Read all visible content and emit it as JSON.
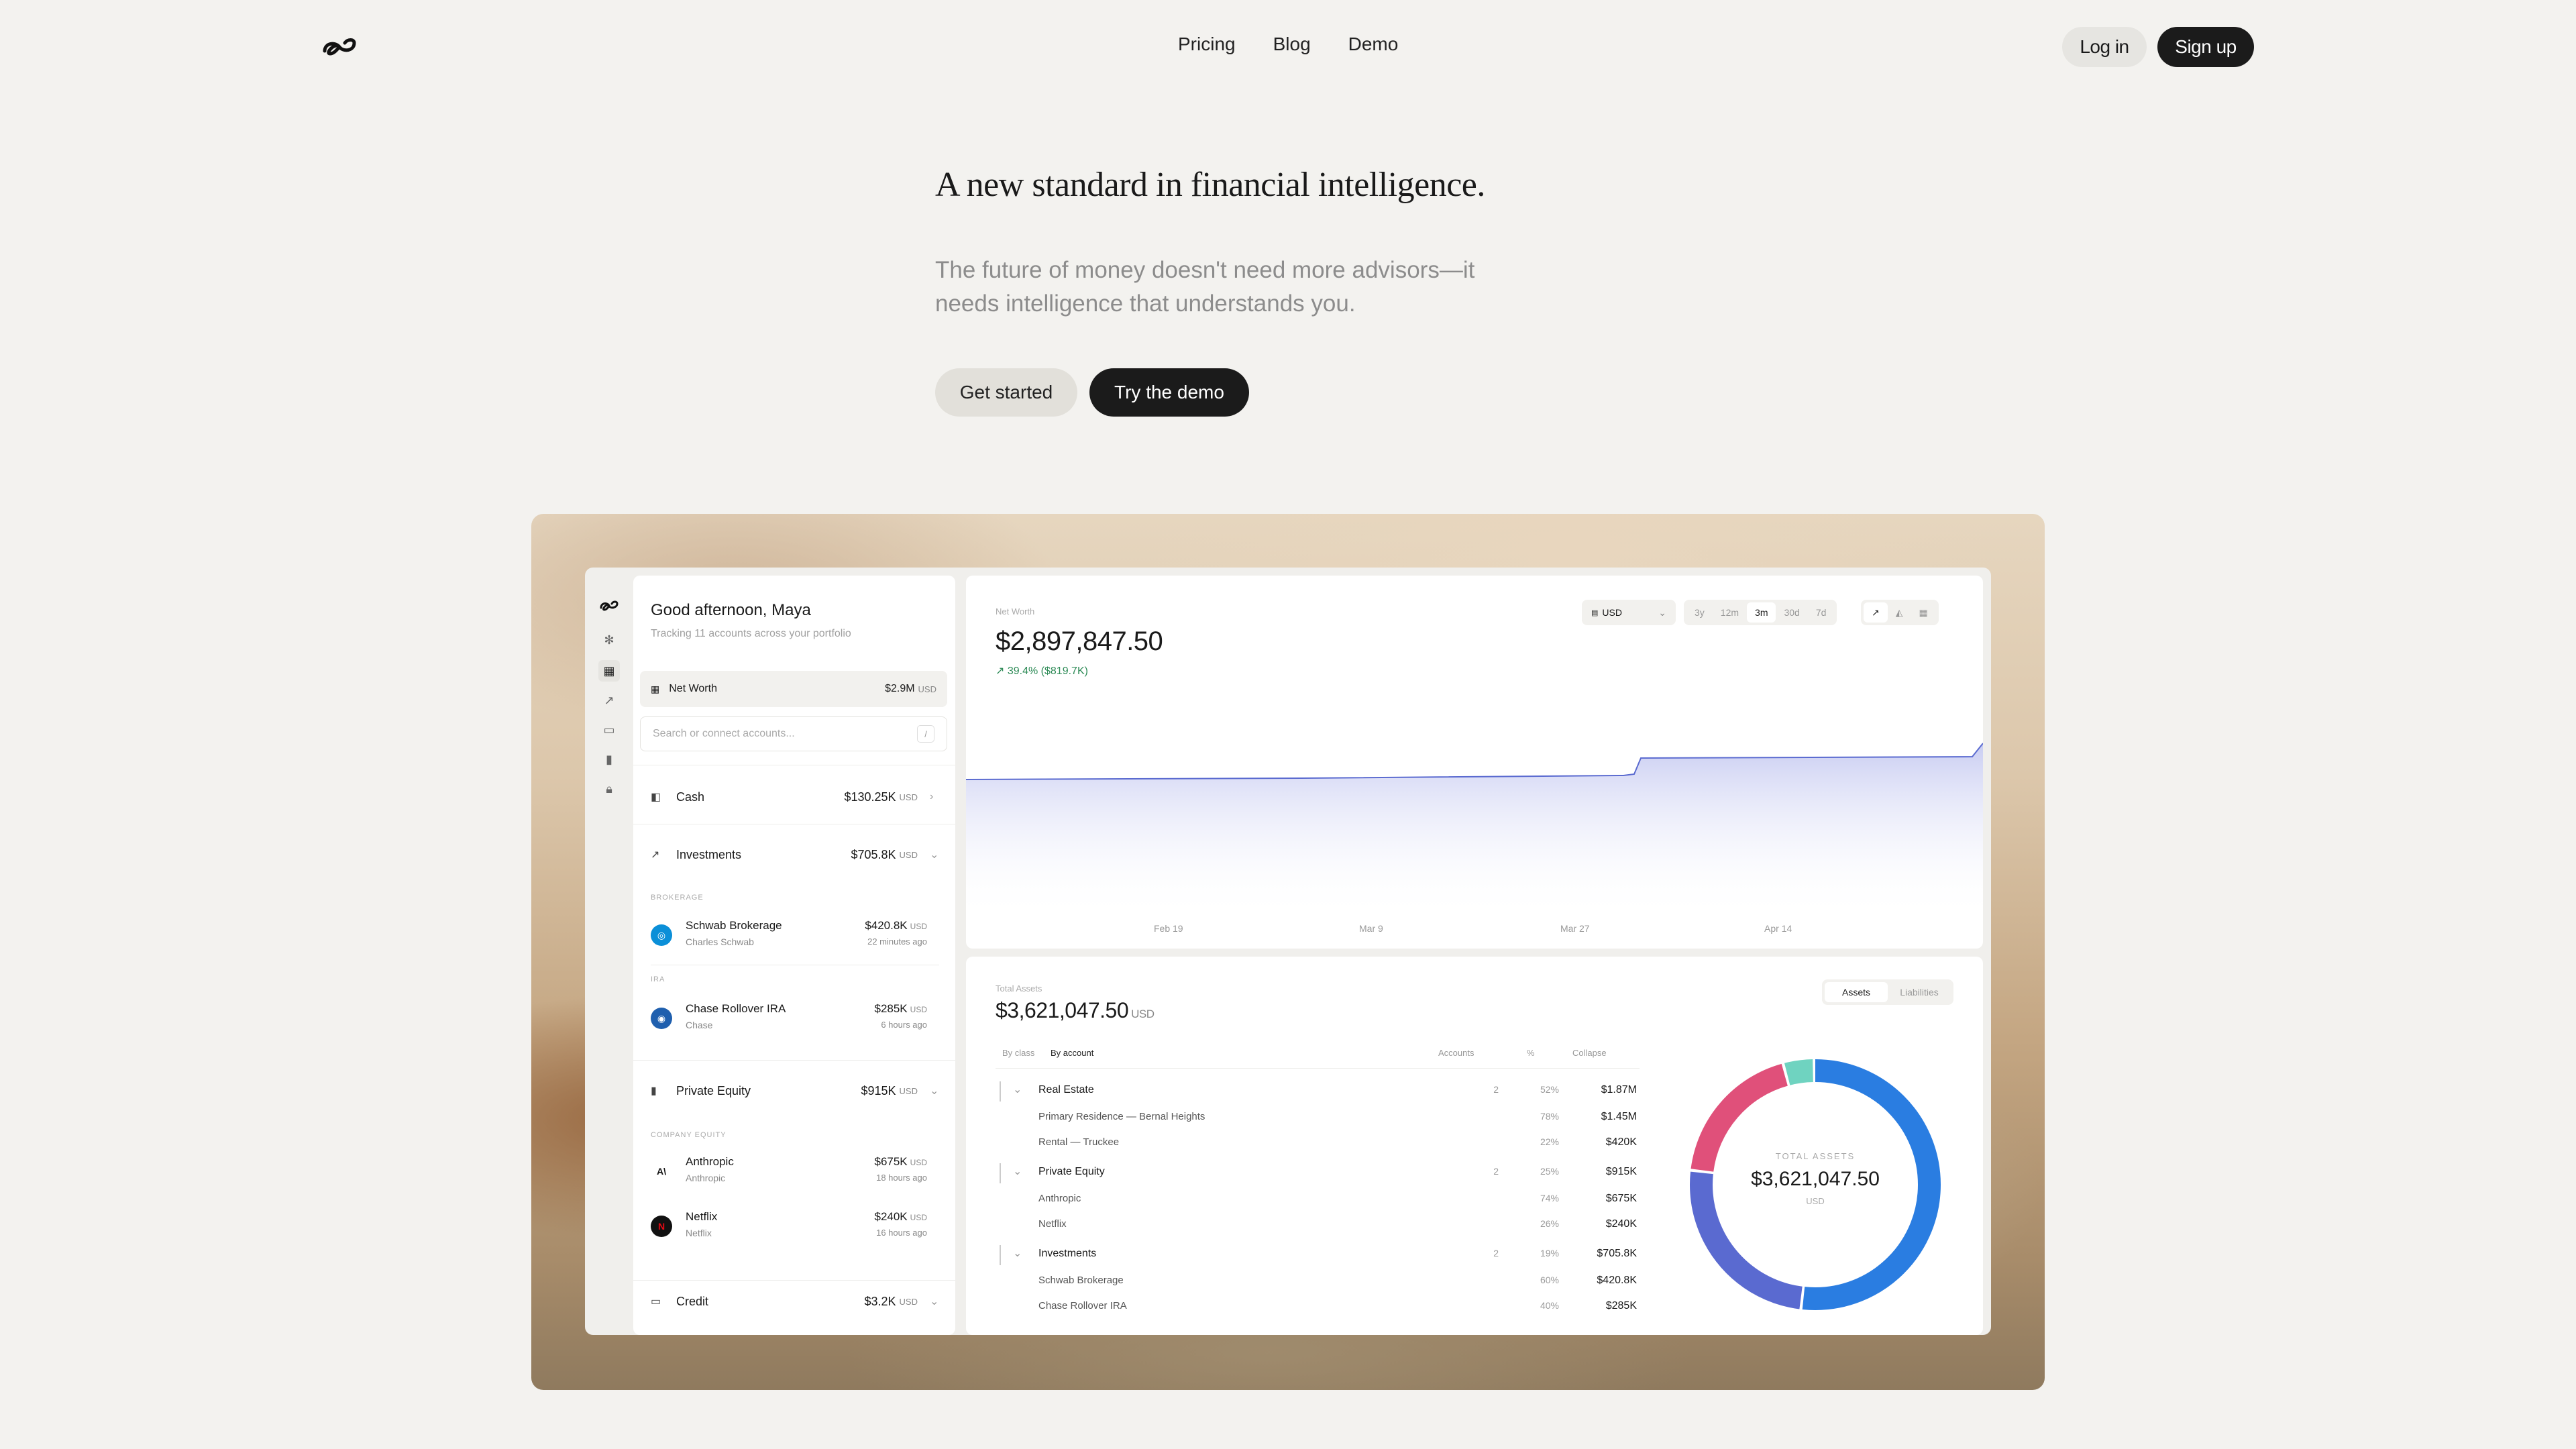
{
  "nav": {
    "links": [
      "Pricing",
      "Blog",
      "Demo"
    ],
    "login": "Log in",
    "signup": "Sign up"
  },
  "hero": {
    "title": "A new standard in financial intelligence.",
    "subtitle_line1": "The future of money doesn't need more advisors—it",
    "subtitle_line2": "needs intelligence that understands you.",
    "get_started": "Get started",
    "try_demo": "Try the demo"
  },
  "app": {
    "greeting": "Good afternoon, Maya",
    "greeting_sub": "Tracking 11 accounts across your portfolio",
    "net_worth_label": "Net Worth",
    "net_worth_value": "$2.9M",
    "usd": "USD",
    "search_placeholder": "Search or connect accounts...",
    "search_key": "/",
    "categories": [
      {
        "name": "Cash",
        "value": "$130.25K"
      },
      {
        "name": "Investments",
        "value": "$705.8K"
      },
      {
        "name": "Private Equity",
        "value": "$915K"
      },
      {
        "name": "Credit",
        "value": "$3.2K"
      }
    ],
    "groups": [
      "BROKERAGE",
      "IRA",
      "COMPANY EQUITY"
    ],
    "accounts": [
      {
        "name": "Schwab Brokerage",
        "inst": "Charles Schwab",
        "value": "$420.8K",
        "time": "22 minutes ago"
      },
      {
        "name": "Chase Rollover IRA",
        "inst": "Chase",
        "value": "$285K",
        "time": "6 hours ago"
      },
      {
        "name": "Anthropic",
        "inst": "Anthropic",
        "value": "$675K",
        "time": "18 hours ago"
      },
      {
        "name": "Netflix",
        "inst": "Netflix",
        "value": "$240K",
        "time": "16 hours ago"
      }
    ],
    "chart_card": {
      "label": "Net Worth",
      "value": "$2,897,847.50",
      "change": "39.4% ($819.7K)",
      "currency": "USD",
      "ranges": [
        "3y",
        "12m",
        "3m",
        "30d",
        "7d"
      ],
      "active_range": "3m",
      "x_ticks": [
        "Feb 19",
        "Mar 9",
        "Mar 27",
        "Apr 14"
      ]
    },
    "assets_card": {
      "label": "Total Assets",
      "value": "$3,621,047.50",
      "tabs": [
        "Assets",
        "Liabilities"
      ],
      "view_by_class": "By class",
      "view_by_account": "By account",
      "col_accounts": "Accounts",
      "col_pct": "%",
      "col_collapse": "Collapse",
      "rows": [
        {
          "name": "Real Estate",
          "accounts": "2",
          "pct": "52%",
          "value": "$1.87M",
          "sub": false
        },
        {
          "name": "Primary Residence — Bernal Heights",
          "accounts": "",
          "pct": "78%",
          "value": "$1.45M",
          "sub": true
        },
        {
          "name": "Rental — Truckee",
          "accounts": "",
          "pct": "22%",
          "value": "$420K",
          "sub": true
        },
        {
          "name": "Private Equity",
          "accounts": "2",
          "pct": "25%",
          "value": "$915K",
          "sub": false
        },
        {
          "name": "Anthropic",
          "accounts": "",
          "pct": "74%",
          "value": "$675K",
          "sub": true
        },
        {
          "name": "Netflix",
          "accounts": "",
          "pct": "26%",
          "value": "$240K",
          "sub": true
        },
        {
          "name": "Investments",
          "accounts": "2",
          "pct": "19%",
          "value": "$705.8K",
          "sub": false
        },
        {
          "name": "Schwab Brokerage",
          "accounts": "",
          "pct": "60%",
          "value": "$420.8K",
          "sub": true
        },
        {
          "name": "Chase Rollover IRA",
          "accounts": "",
          "pct": "40%",
          "value": "$285K",
          "sub": true
        }
      ],
      "donut_label": "TOTAL ASSETS",
      "donut_value": "$3,621,047.50",
      "donut_unit": "USD"
    }
  },
  "colors": {
    "accent": "#1b1b1b",
    "positive": "#2e8b57",
    "real_estate": "#2a7de1",
    "private_equity": "#5a6ad0",
    "investments": "#e0507a",
    "cash": "#6fd3c0"
  }
}
